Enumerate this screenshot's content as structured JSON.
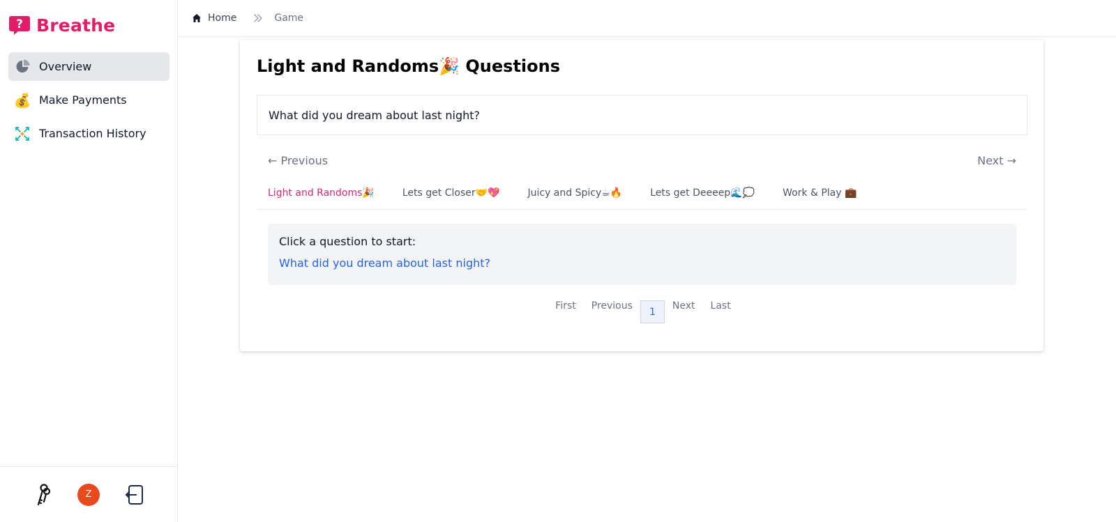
{
  "brand": {
    "name": "Breathe",
    "color": "#e11d6a"
  },
  "sidebar": {
    "items": [
      {
        "label": "Overview",
        "icon": "pie-chart-icon",
        "active": true
      },
      {
        "label": "Make Payments",
        "icon": "money-bag-icon",
        "glyph": "💰"
      },
      {
        "label": "Transaction History",
        "icon": "sparkle-arrows-icon"
      }
    ],
    "footer": {
      "avatar_initial": "Z",
      "avatar_color": "#e8491d"
    }
  },
  "breadcrumb": {
    "home": "Home",
    "current": "Game"
  },
  "main": {
    "title": "Light and Randoms🎉 Questions",
    "current_question": "What did you dream about last night?",
    "prev_label": "← Previous",
    "next_label": "Next →",
    "tabs": [
      {
        "label": "Light and Randoms🎉",
        "active": true
      },
      {
        "label": "Lets get Closer🤝💖"
      },
      {
        "label": "Juicy and Spicy☕🔥"
      },
      {
        "label": "Lets get Deeeep🌊💭"
      },
      {
        "label": "Work & Play 💼"
      }
    ],
    "start_heading": "Click a question to start:",
    "question_link": "What did you dream about last night?",
    "pagination": {
      "first": "First",
      "previous": "Previous",
      "current": "1",
      "next": "Next",
      "last": "Last"
    }
  },
  "colors": {
    "accent": "#db2777",
    "link": "#2563eb"
  }
}
